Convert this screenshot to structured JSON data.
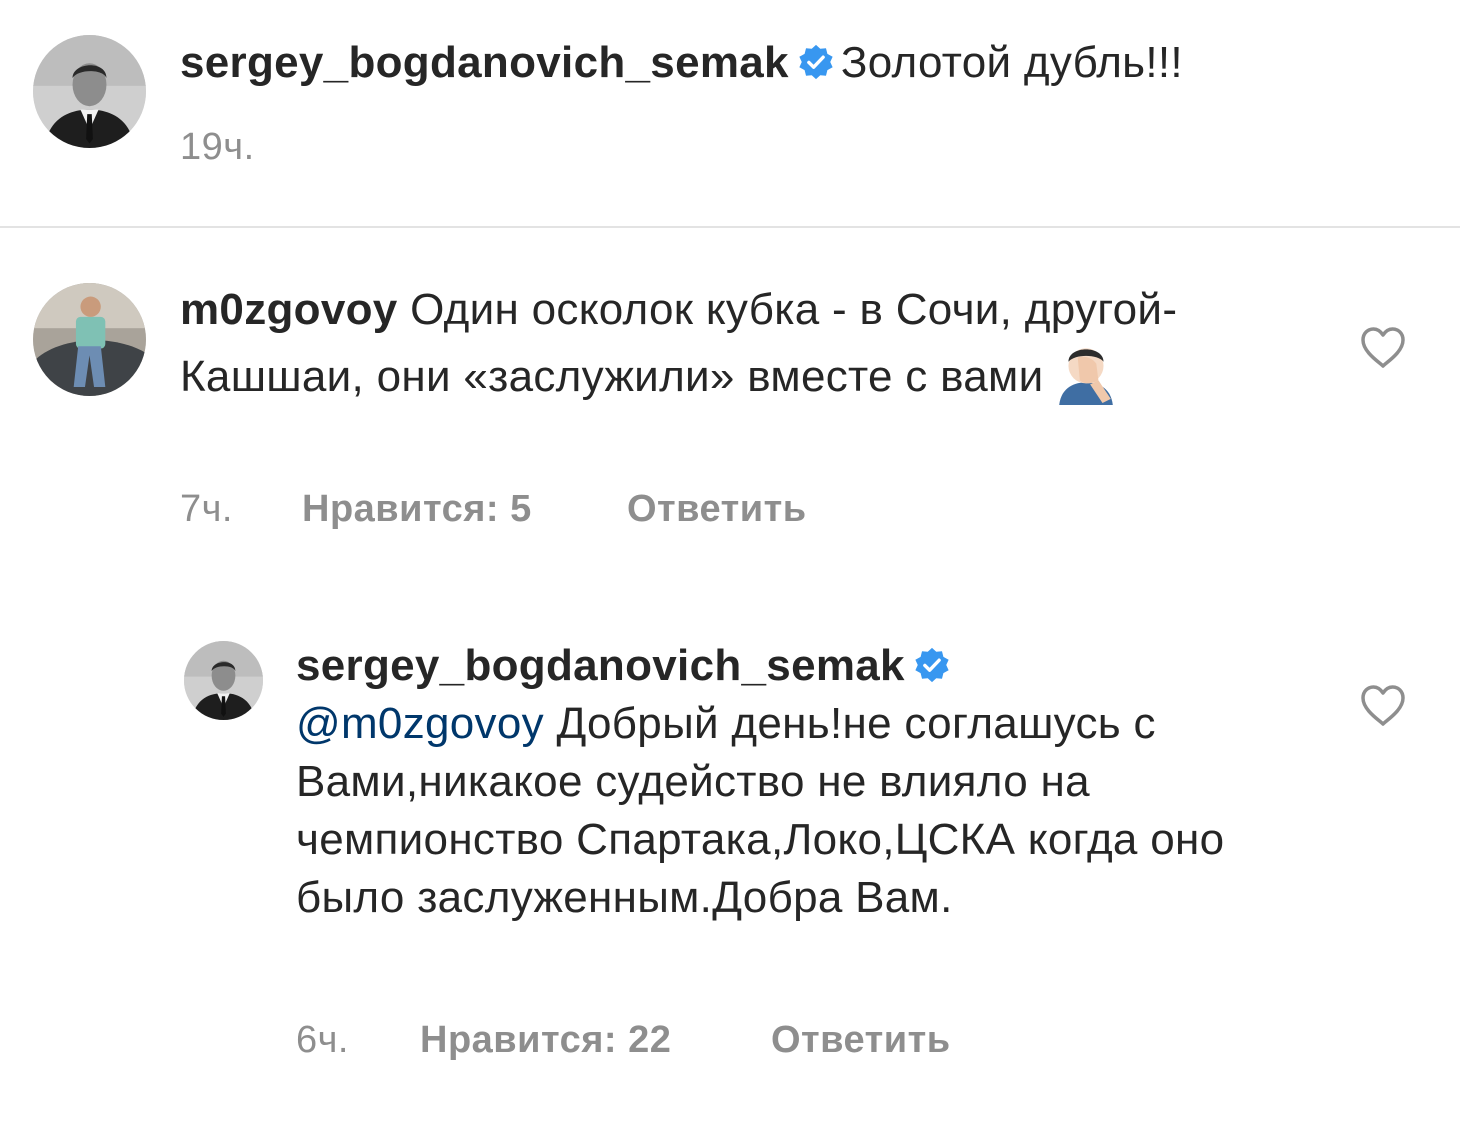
{
  "caption": {
    "username": "sergey_bogdanovich_semak",
    "text": "Золотой дубль!!!",
    "time": "19ч."
  },
  "comments": [
    {
      "username": "m0zgovoy",
      "text": "Один осколок кубка - в Сочи, другой- Кашшаи, они «заслужили» вместе с вами",
      "emoji": "face-palm-emoji",
      "time": "7ч.",
      "likes_label": "Нравится: 5",
      "reply_label": "Ответить"
    },
    {
      "username": "sergey_bogdanovich_semak",
      "mention": "@m0zgovoy",
      "text": "Добрый день!не соглашусь с Вами,никакое судейство не влияло на чемпионство Спартака,Локо,ЦСКА когда оно было заслуженным.Добра Вам.",
      "time": "6ч.",
      "likes_label": "Нравится: 22",
      "reply_label": "Ответить"
    }
  ],
  "colors": {
    "verified": "#3897f0",
    "mention": "#00376b",
    "meta": "#8e8e8e",
    "text": "#262626"
  }
}
